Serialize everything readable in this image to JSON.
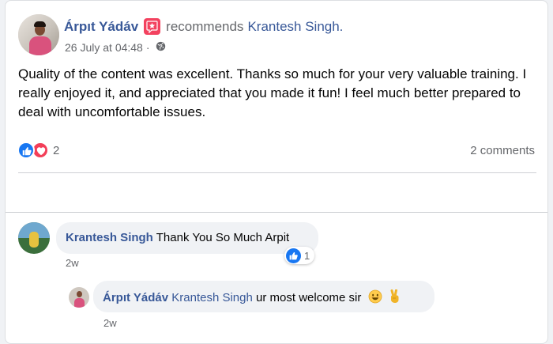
{
  "post": {
    "author": "Árpıt Yádáv",
    "action": "recommends",
    "target": "Krantesh Singh.",
    "timestamp": "26 July at 04:48",
    "privacy_icon": "globe-icon",
    "badge_icon": "recommendation-star-icon",
    "content": "Quality of the content was excellent. Thanks so much for your very valuable training. I really enjoyed it, and appreciated that you made it fun! I feel much better prepared to deal with uncomfortable issues.",
    "reaction_count": "2",
    "reaction_icons": [
      "like-icon",
      "love-icon"
    ],
    "comments_count": "2 comments"
  },
  "comments": [
    {
      "author": "Krantesh Singh",
      "text": "Thank You So Much Arpit",
      "time": "2w",
      "reaction_count": "1",
      "reaction_icon": "like-icon"
    },
    {
      "author": "Árpıt Yádáv",
      "mention": "Krantesh Singh",
      "text": "ur most welcome sir",
      "emojis": [
        "smiling-face-icon",
        "victory-hand-icon"
      ],
      "time": "2w"
    }
  ],
  "colors": {
    "link": "#385898",
    "like": "#1877f2",
    "love": "#f33e58",
    "badge": "#f3425f",
    "secondary_text": "#65676b",
    "bubble": "#f0f2f5"
  }
}
